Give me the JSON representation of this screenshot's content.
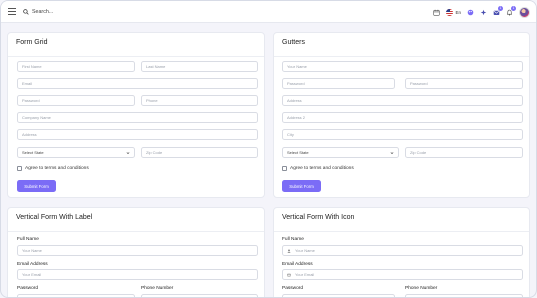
{
  "topbar": {
    "search_label": "Search...",
    "language": "En",
    "notif_count": "1",
    "msg_count": "1"
  },
  "form_grid": {
    "title": "Form Grid",
    "first_name": "First Name",
    "last_name": "Last Name",
    "email": "Email",
    "password": "Password",
    "phone": "Phone",
    "company": "Company Name",
    "address": "Address",
    "state": "Select State",
    "zip": "Zip Code",
    "agree": "Agree to terms and conditions",
    "submit": "Submit Form"
  },
  "gutters": {
    "title": "Gutters",
    "name": "Your Name",
    "password": "Password",
    "address": "Address",
    "address2": "Address 2",
    "city": "City",
    "state": "Select State",
    "zip": "Zip Code",
    "agree": "Agree to terms and conditions",
    "submit": "Submit Form"
  },
  "vertical_label": {
    "title": "Vertical Form With Label",
    "full_name_label": "Full Name",
    "full_name_ph": "Your Name",
    "email_label": "Email Address",
    "email_ph": "Your Email",
    "password_label": "Password",
    "phone_label": "Phone Number"
  },
  "vertical_icon": {
    "title": "Vertical Form With Icon",
    "full_name_label": "Full Name",
    "full_name_ph": "Your Name",
    "email_label": "Email Address",
    "email_ph": "Your Email",
    "password_label": "Password",
    "phone_label": "Phone Number"
  }
}
